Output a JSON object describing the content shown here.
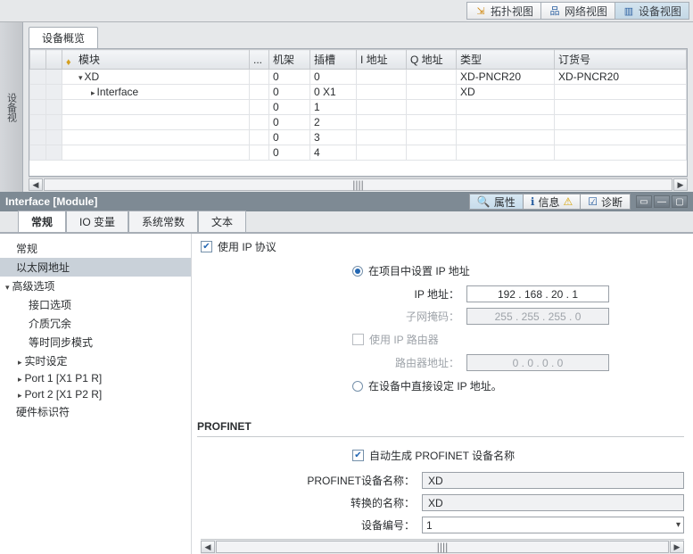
{
  "top_views": {
    "topology": "拓扑视图",
    "network": "网络视图",
    "device": "设备视图"
  },
  "side_tab": "设备视",
  "overview": {
    "tab": "设备概览",
    "columns": {
      "module": "模块",
      "dots": "...",
      "rack": "机架",
      "slot": "插槽",
      "iaddr": "I 地址",
      "qaddr": "Q 地址",
      "type": "类型",
      "order": "订货号"
    },
    "rows": [
      {
        "module": "XD",
        "indent": 1,
        "expand": "open",
        "rack": "0",
        "slot": "0",
        "type": "XD-PNCR20",
        "order": "XD-PNCR20"
      },
      {
        "module": "Interface",
        "indent": 2,
        "expand": "closed",
        "rack": "0",
        "slot": "0 X1",
        "type": "XD",
        "order": "",
        "sel": true
      },
      {
        "module": "",
        "rack": "0",
        "slot": "1",
        "type": "",
        "order": ""
      },
      {
        "module": "",
        "rack": "0",
        "slot": "2",
        "type": "",
        "order": ""
      },
      {
        "module": "",
        "rack": "0",
        "slot": "3",
        "type": "",
        "order": ""
      },
      {
        "module": "",
        "rack": "0",
        "slot": "4",
        "type": "",
        "order": ""
      }
    ]
  },
  "inspector": {
    "title": "Interface [Module]",
    "rtabs": {
      "props": "属性",
      "info": "信息",
      "diag": "诊断"
    },
    "tabs": [
      "常规",
      "IO 变量",
      "系统常数",
      "文本"
    ],
    "nav": [
      {
        "label": "常规",
        "cls": ""
      },
      {
        "label": "以太网地址",
        "cls": "sel"
      },
      {
        "label": "高级选项",
        "cls": "hd"
      },
      {
        "label": "接口选项",
        "cls": "lv2"
      },
      {
        "label": "介质冗余",
        "cls": "lv2"
      },
      {
        "label": "等时同步模式",
        "cls": "lv2"
      },
      {
        "label": "实时设定",
        "cls": "hd2 lv2"
      },
      {
        "label": "Port 1 [X1 P1 R]",
        "cls": "hd2 lv2"
      },
      {
        "label": "Port 2 [X1 P2 R]",
        "cls": "hd2 lv2"
      },
      {
        "label": "硬件标识符",
        "cls": ""
      }
    ],
    "panel": {
      "use_ip": "使用 IP 协议",
      "set_in_project": "在项目中设置 IP 地址",
      "ip_lbl": "IP 地址：",
      "ip_val": "192 . 168 .  20  .  1",
      "mask_lbl": "子网掩码：",
      "mask_val": "255 . 255 . 255 . 0",
      "use_router": "使用 IP 路由器",
      "router_lbl": "路由器地址：",
      "router_val": "0    . 0     . 0    . 0",
      "set_on_device": "在设备中直接设定 IP 地址。",
      "profinet_hdr": "PROFINET",
      "auto_name": "自动生成 PROFINET 设备名称",
      "pn_name_lbl": "PROFINET设备名称：",
      "pn_name_val": "XD",
      "conv_name_lbl": "转换的名称：",
      "conv_name_val": "XD",
      "dev_no_lbl": "设备编号：",
      "dev_no_val": "1"
    }
  }
}
